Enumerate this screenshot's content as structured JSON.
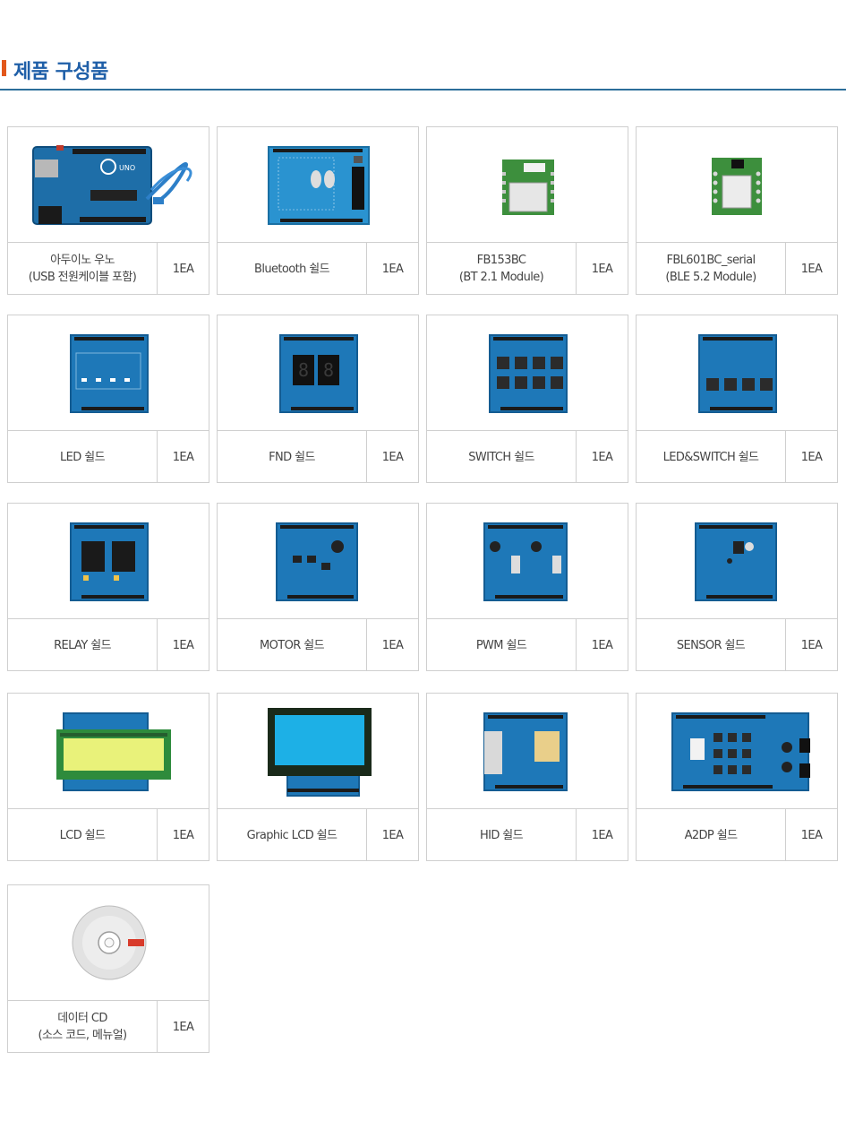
{
  "section_title": "제품 구성품",
  "items": [
    {
      "name": "아두이노 우노\n(USB 전원케이블 포함)",
      "qty": "1EA",
      "icon": "arduino-uno-board-icon"
    },
    {
      "name": "Bluetooth 쉴드",
      "qty": "1EA",
      "icon": "bluetooth-shield-icon"
    },
    {
      "name": "FB153BC\n(BT 2.1 Module)",
      "qty": "1EA",
      "icon": "fb153bc-module-icon"
    },
    {
      "name": "FBL601BC_serial\n(BLE 5.2 Module)",
      "qty": "1EA",
      "icon": "fbl601bc-module-icon"
    },
    {
      "name": "LED 쉴드",
      "qty": "1EA",
      "icon": "led-shield-icon"
    },
    {
      "name": "FND 쉴드",
      "qty": "1EA",
      "icon": "fnd-shield-icon"
    },
    {
      "name": "SWITCH 쉴드",
      "qty": "1EA",
      "icon": "switch-shield-icon"
    },
    {
      "name": "LED&SWITCH 쉴드",
      "qty": "1EA",
      "icon": "led-switch-shield-icon"
    },
    {
      "name": "RELAY 쉴드",
      "qty": "1EA",
      "icon": "relay-shield-icon"
    },
    {
      "name": "MOTOR 쉴드",
      "qty": "1EA",
      "icon": "motor-shield-icon"
    },
    {
      "name": "PWM 쉴드",
      "qty": "1EA",
      "icon": "pwm-shield-icon"
    },
    {
      "name": "SENSOR 쉴드",
      "qty": "1EA",
      "icon": "sensor-shield-icon"
    },
    {
      "name": "LCD 쉴드",
      "qty": "1EA",
      "icon": "lcd-shield-icon"
    },
    {
      "name": "Graphic LCD 쉴드",
      "qty": "1EA",
      "icon": "graphic-lcd-shield-icon"
    },
    {
      "name": "HID 쉴드",
      "qty": "1EA",
      "icon": "hid-shield-icon"
    },
    {
      "name": "A2DP 쉴드",
      "qty": "1EA",
      "icon": "a2dp-shield-icon"
    },
    {
      "name": "데이터 CD\n(소스 코드, 메뉴얼)",
      "qty": "1EA",
      "icon": "data-cd-icon"
    }
  ],
  "colors": {
    "accent_bar": "#e2571b",
    "title": "#1f5fa8",
    "rule": "#2c6e9a",
    "pcb": "#1e78b8",
    "pcb_dark": "#145c92",
    "board_header": "#1a1a1a"
  }
}
